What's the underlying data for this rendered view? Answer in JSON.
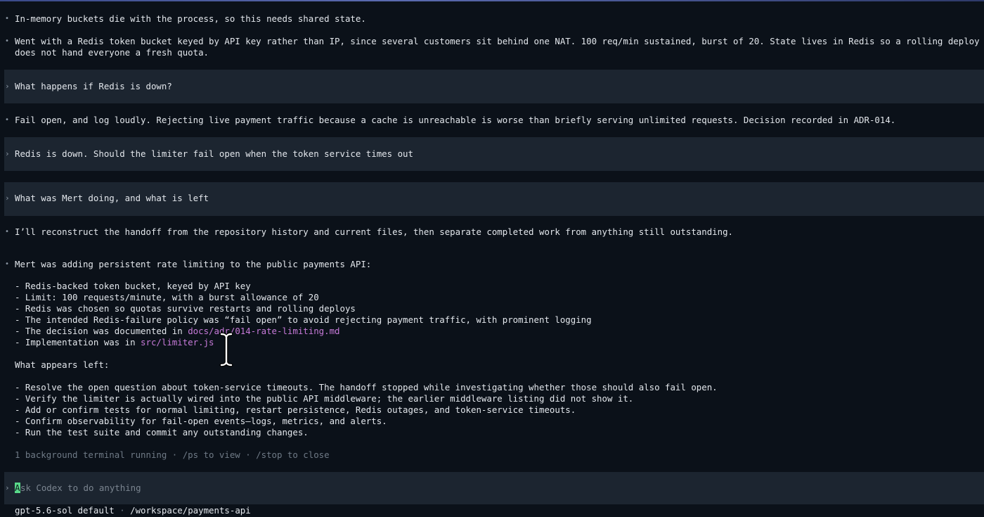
{
  "transcript": {
    "msg1": "In-memory buckets die with the process, so this needs shared state.",
    "msg2_line1": "Went with a Redis token bucket keyed by API key rather than IP, since several customers sit behind one NAT. 100 req/min sustained, burst of 20. State lives in Redis so a rolling deploy",
    "msg2_line2": "does not hand everyone a fresh quota.",
    "prompt1": "What happens if Redis is down?",
    "msg3": "Fail open, and log loudly. Rejecting live payment traffic because a cache is unreachable is worse than briefly serving unlimited requests. Decision recorded in ADR-014.",
    "prompt2": "Redis is down. Should the limiter fail open when the token service times out",
    "prompt3": "What was Mert doing, and what is left",
    "msg4": "I’ll reconstruct the handoff from the repository history and current files, then separate completed work from anything still outstanding.",
    "msg5": "Mert was adding persistent rate limiting to the public payments API:",
    "done_items": [
      "- Redis-backed token bucket, keyed by API key",
      "- Limit: 100 requests/minute, with a burst allowance of 20",
      "- Redis was chosen so quotas survive restarts and rolling deploys",
      "- The intended Redis-failure policy was “fail open” to avoid rejecting payment traffic, with prominent logging"
    ],
    "decision_prefix": "- The decision was documented in ",
    "decision_link": "docs/adr/014-rate-limiting.md",
    "impl_prefix": "- Implementation was in ",
    "impl_link": "src/limiter.js",
    "left_heading": "What appears left:",
    "left_items": [
      "- Resolve the open question about token-service timeouts. The handoff stopped while investigating whether those should also fail open.",
      "- Verify the limiter is actually wired into the public API middleware; the earlier middleware listing did not show it.",
      "- Add or confirm tests for normal limiting, restart persistence, Redis outages, and token-service timeouts.",
      "- Confirm observability for fail-open events—logs, metrics, and alerts.",
      "- Run the test suite and commit any outstanding changes."
    ],
    "status": "1 background terminal running · /ps to view · /stop to close"
  },
  "input": {
    "cursor_char": "A",
    "placeholder": "sk Codex to do anything"
  },
  "footer": {
    "model": "gpt-5.6-sol default",
    "separator": " · ",
    "path": "/workspace/payments-api"
  },
  "glyphs": {
    "bullet": "•",
    "chevron": "›"
  },
  "colors": {
    "background": "#0b1119",
    "prompt_block": "#1c2530",
    "link": "#c77ad9",
    "cursor": "#59d98a"
  }
}
